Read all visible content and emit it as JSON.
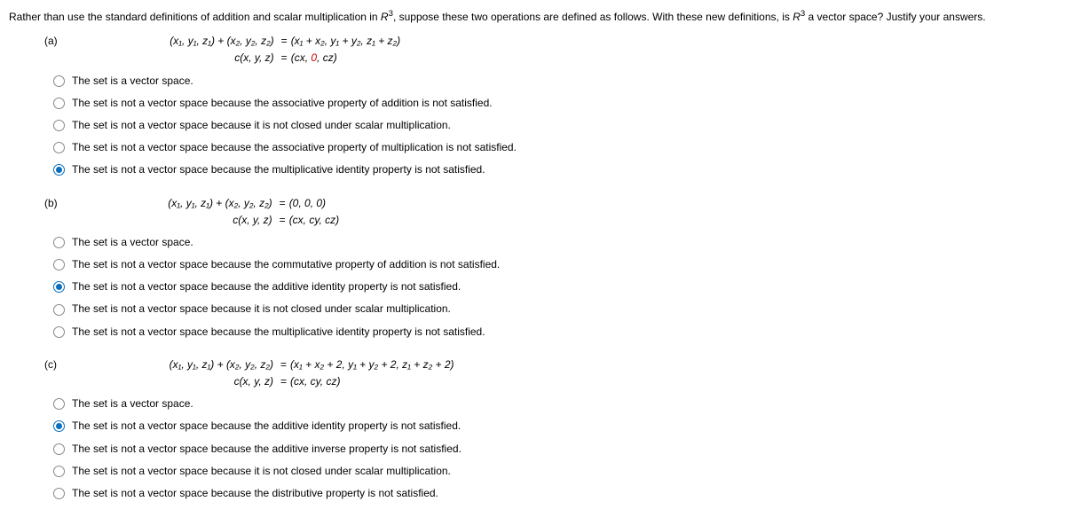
{
  "intro_prefix": "Rather than use the standard definitions of addition and scalar multiplication in ",
  "intro_R": "R",
  "intro_sup": "3",
  "intro_mid": ", suppose these two operations are defined as follows. With these new definitions, is ",
  "intro_R2": "R",
  "intro_sup2": "3",
  "intro_suffix": " a vector space? Justify your answers.",
  "a": {
    "label": "(a)",
    "eq1_left": "(x₁, y₁, z₁) + (x₂, y₂, z₂)",
    "eq1_eq": "=",
    "eq1_right": "(x₁ + x₂, y₁ + y₂, z₁ + z₂)",
    "eq2_left": "c(x, y, z)",
    "eq2_eq": "=",
    "eq2_right_open": "(",
    "eq2_right_cx": "cx",
    "eq2_right_c1": ", ",
    "eq2_right_zero": "0",
    "eq2_right_c2": ", ",
    "eq2_right_cz": "cz",
    "eq2_right_close": ")",
    "opt1": "The set is a vector space.",
    "opt2": "The set is not a vector space because the associative property of addition is not satisfied.",
    "opt3": "The set is not a vector space because it is not closed under scalar multiplication.",
    "opt4": "The set is not a vector space because the associative property of multiplication is not satisfied.",
    "opt5": "The set is not a vector space because the multiplicative identity property is not satisfied."
  },
  "b": {
    "label": "(b)",
    "eq1_left": "(x₁, y₁, z₁) + (x₂, y₂, z₂)",
    "eq1_eq": "=",
    "eq1_right": "(0, 0, 0)",
    "eq2_left": "c(x, y, z)",
    "eq2_eq": "=",
    "eq2_right": "(cx, cy, cz)",
    "opt1": "The set is a vector space.",
    "opt2": "The set is not a vector space because the commutative property of addition is not satisfied.",
    "opt3": "The set is not a vector space because the additive identity property is not satisfied.",
    "opt4": "The set is not a vector space because it is not closed under scalar multiplication.",
    "opt5": "The set is not a vector space because the multiplicative identity property is not satisfied."
  },
  "c": {
    "label": "(c)",
    "eq1_left": "(x₁, y₁, z₁) + (x₂, y₂, z₂)",
    "eq1_eq": "=",
    "eq1_right": "(x₁ + x₂ + 2, y₁ + y₂ + 2, z₁ + z₂ + 2)",
    "eq2_left": "c(x, y, z)",
    "eq2_eq": "=",
    "eq2_right": "(cx, cy, cz)",
    "opt1": "The set is a vector space.",
    "opt2": "The set is not a vector space because the additive identity property is not satisfied.",
    "opt3": "The set is not a vector space because the additive inverse property is not satisfied.",
    "opt4": "The set is not a vector space because it is not closed under scalar multiplication.",
    "opt5": "The set is not a vector space because the distributive property is not satisfied."
  }
}
